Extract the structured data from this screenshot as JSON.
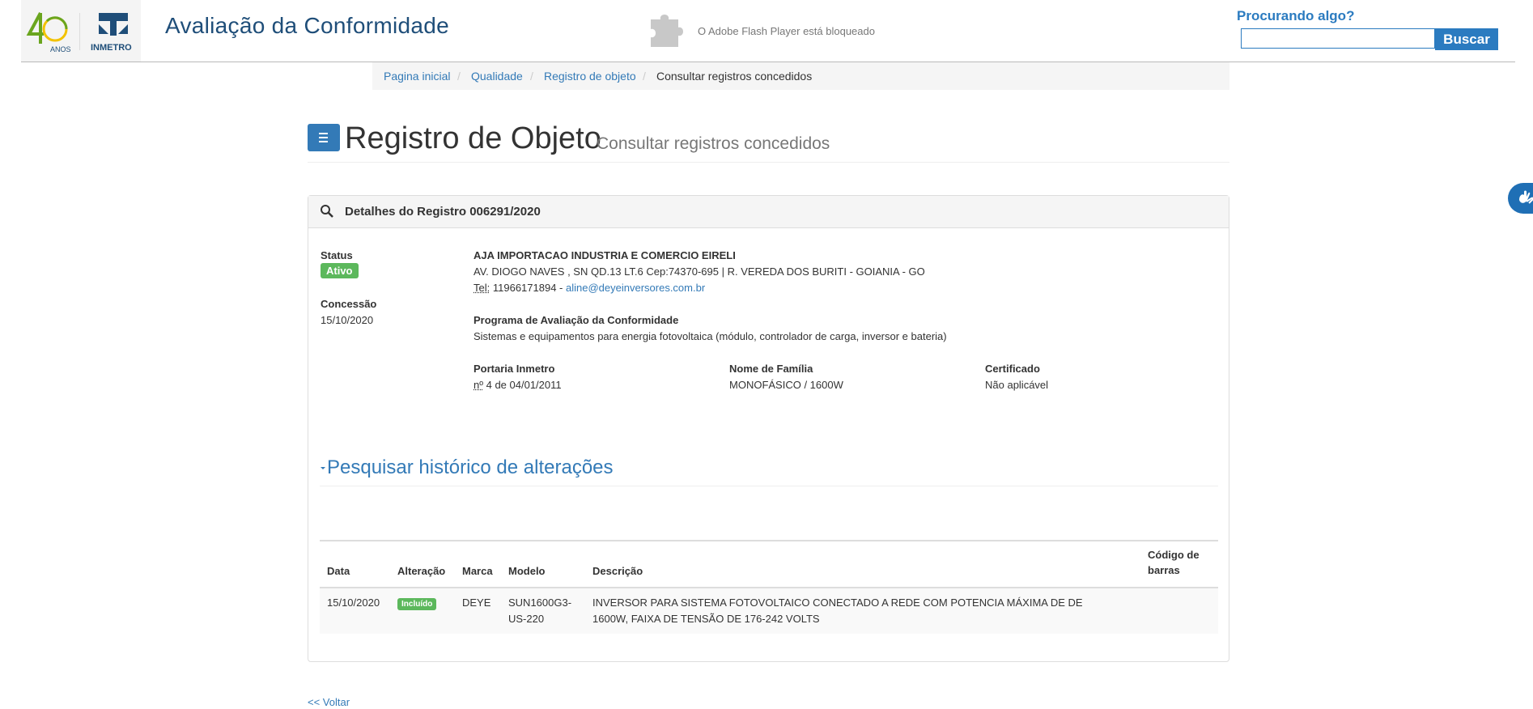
{
  "header": {
    "logo40_text": "ANOS",
    "inmetro_text": "INMETRO",
    "site_title": "Avaliação da Conformidade",
    "flash_notice": "O Adobe Flash Player está bloqueado",
    "search_label": "Procurando algo?",
    "search_value": "",
    "search_button": "Buscar"
  },
  "breadcrumb": {
    "items": [
      "Pagina inicial",
      "Qualidade",
      "Registro de objeto",
      "Consultar registros concedidos"
    ],
    "separator": "/"
  },
  "page": {
    "title": "Registro de Objeto",
    "subtitle": "Consultar registros concedidos"
  },
  "panel": {
    "heading": "Detalhes do Registro 006291/2020",
    "status_label": "Status",
    "status_value": "Ativo",
    "concessao_label": "Concessão",
    "concessao_value": "15/10/2020",
    "company_name": "AJA IMPORTACAO INDUSTRIA E COMERCIO EIRELI",
    "address": "AV. DIOGO NAVES , SN QD.13 LT.6 Cep:74370-695 | R. VEREDA DOS BURITI - GOIANIA - GO",
    "tel_label": "Tel:",
    "tel_value": "11966171894 -",
    "email": "aline@deyeinversores.com.br",
    "programa_label": "Programa de Avaliação da Conformidade",
    "programa_value": "Sistemas e equipamentos para energia fotovoltaica (módulo, controlador de carga, inversor e bateria)",
    "portaria_label": "Portaria Inmetro",
    "portaria_abbr": "nº",
    "portaria_value": "4 de 04/01/2011",
    "familia_label": "Nome de Família",
    "familia_value": "MONOFÁSICO / 1600W",
    "certificado_label": "Certificado",
    "certificado_value": "Não aplicável",
    "history_link": "Pesquisar histórico de alterações"
  },
  "table": {
    "headers": {
      "data": "Data",
      "alteracao": "Alteração",
      "marca": "Marca",
      "modelo": "Modelo",
      "descricao": "Descrição",
      "codigo_1": "Código de",
      "codigo_2": "barras"
    },
    "rows": [
      {
        "data": "15/10/2020",
        "alteracao": "Incluído",
        "marca": "DEYE",
        "modelo_1": "SUN1600G3-",
        "modelo_2": "US-220",
        "descricao_1": "INVERSOR PARA SISTEMA FOTOVOLTAICO CONECTADO A REDE COM POTENCIA MÁXIMA DE DE",
        "descricao_2": "1600W, FAIXA DE TENSÃO DE 176-242 VOLTS",
        "codigo": ""
      }
    ]
  },
  "footer": {
    "back_link": "<< Voltar"
  },
  "colors": {
    "brand_blue": "#1f4e79",
    "link_blue": "#337ab7",
    "search_blue": "#2b7bc0",
    "success_green": "#5cb85c"
  },
  "icons": [
    "logo-40-anos",
    "inmetro-logo",
    "puzzle-plugin-icon",
    "menu-icon",
    "search-icon",
    "caret-down-icon",
    "accessibility-hands-icon"
  ]
}
